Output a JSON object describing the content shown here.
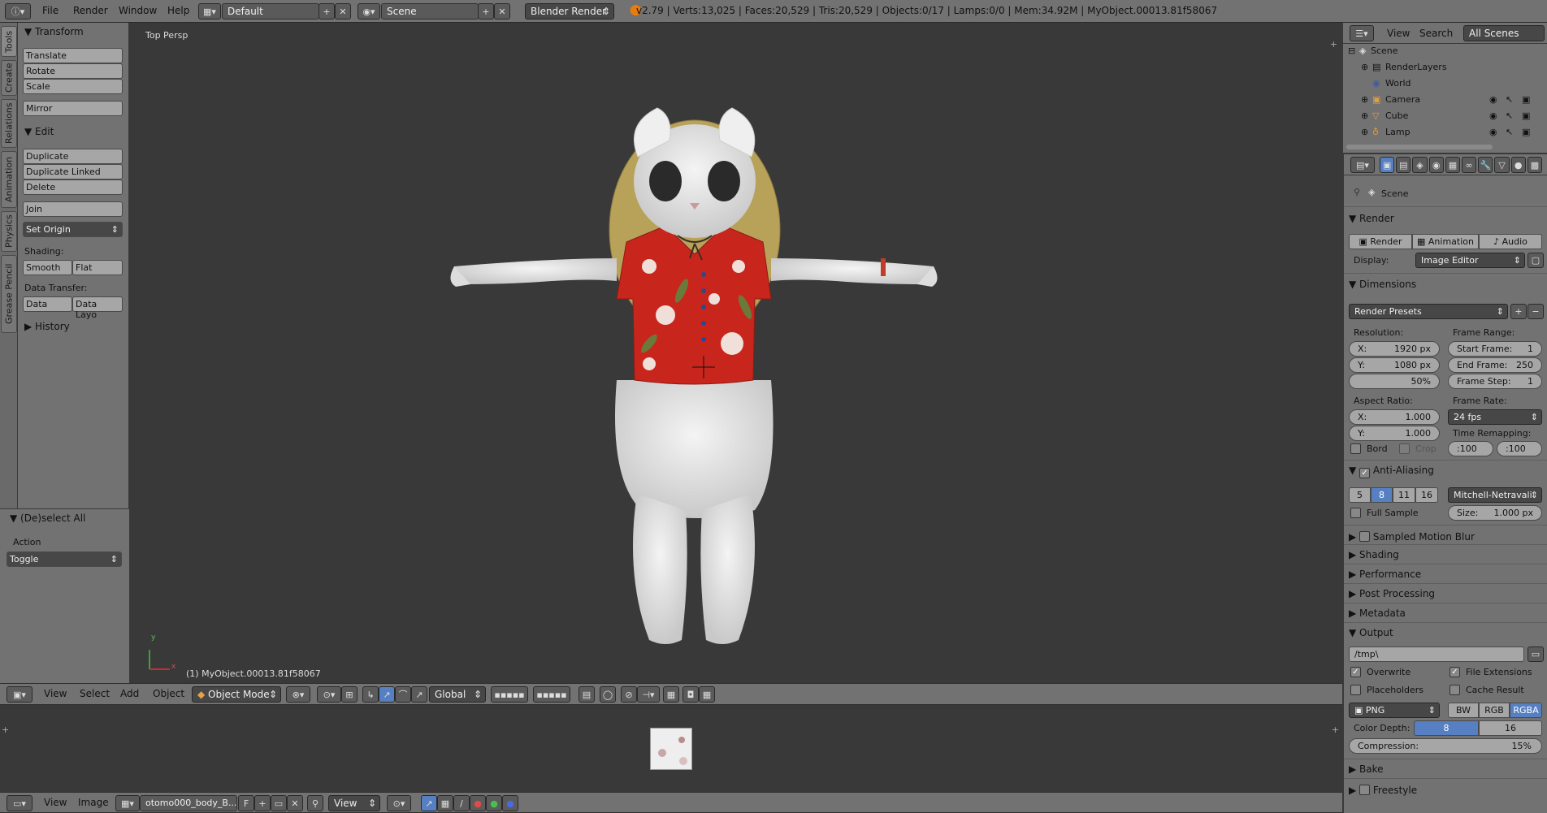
{
  "topbar": {
    "menus": [
      "File",
      "Render",
      "Window",
      "Help"
    ],
    "layout": "Default",
    "scene": "Scene",
    "engine": "Blender Render",
    "stats": "v2.79 | Verts:13,025 | Faces:20,529 | Tris:20,529 | Objects:0/17 | Lamps:0/0 | Mem:34.92M | MyObject.00013.81f58067"
  },
  "tabs": [
    "Tools",
    "Create",
    "Relations",
    "Animation",
    "Physics",
    "Grease Pencil"
  ],
  "toolshelf": {
    "transform_title": "Transform",
    "translate": "Translate",
    "rotate": "Rotate",
    "scale": "Scale",
    "mirror": "Mirror",
    "edit_title": "Edit",
    "duplicate": "Duplicate",
    "duplicate_linked": "Duplicate Linked",
    "delete": "Delete",
    "join": "Join",
    "set_origin": "Set Origin",
    "shading_label": "Shading:",
    "smooth": "Smooth",
    "flat": "Flat",
    "data_transfer_label": "Data Transfer:",
    "data": "Data",
    "data_layout": "Data Layo",
    "history_title": "History"
  },
  "operator": {
    "title": "(De)select All",
    "action_label": "Action",
    "action_value": "Toggle"
  },
  "viewport": {
    "view_name": "Top Persp",
    "object_label": "(1) MyObject.00013.81f58067",
    "axis_x": "x",
    "axis_y": "y"
  },
  "view3d_header": {
    "view": "View",
    "select": "Select",
    "add": "Add",
    "object": "Object",
    "mode": "Object Mode",
    "orientation": "Global"
  },
  "image_header": {
    "view": "View",
    "image": "Image",
    "image_name": "otomo000_body_B...",
    "fake_user": "F",
    "view_menu": "View"
  },
  "outliner": {
    "view": "View",
    "search": "Search",
    "filter": "All Scenes",
    "items": [
      "Scene",
      "RenderLayers",
      "World",
      "Camera",
      "Cube",
      "Lamp"
    ]
  },
  "properties": {
    "context": "Scene",
    "render_title": "Render",
    "render_btn": "Render",
    "animation_btn": "Animation",
    "audio_btn": "Audio",
    "display_label": "Display:",
    "display_value": "Image Editor",
    "dimensions_title": "Dimensions",
    "render_presets": "Render Presets",
    "resolution_label": "Resolution:",
    "res_x": "X:",
    "res_x_val": "1920 px",
    "res_y": "Y:",
    "res_y_val": "1080 px",
    "res_pct": "50%",
    "frame_range_label": "Frame Range:",
    "start_frame": "Start Frame:",
    "start_frame_val": "1",
    "end_frame": "End Frame:",
    "end_frame_val": "250",
    "frame_step": "Frame Step:",
    "frame_step_val": "1",
    "aspect_label": "Aspect Ratio:",
    "asp_x": "X:",
    "asp_x_val": "1.000",
    "asp_y": "Y:",
    "asp_y_val": "1.000",
    "frame_rate_label": "Frame Rate:",
    "frame_rate_val": "24 fps",
    "time_remap_label": "Time Remapping:",
    "remap_old": ":100",
    "remap_new": ":100",
    "bord": "Bord",
    "crop": "Crop",
    "aa_title": "Anti-Aliasing",
    "aa_5": "5",
    "aa_8": "8",
    "aa_11": "11",
    "aa_16": "16",
    "aa_filter": "Mitchell-Netravali",
    "full_sample": "Full Sample",
    "size_label": "Size:",
    "size_val": "1.000 px",
    "motion_blur": "Sampled Motion Blur",
    "shading": "Shading",
    "performance": "Performance",
    "post_processing": "Post Processing",
    "metadata": "Metadata",
    "output_title": "Output",
    "output_path": "/tmp\\",
    "overwrite": "Overwrite",
    "file_extensions": "File Extensions",
    "placeholders": "Placeholders",
    "cache_result": "Cache Result",
    "format": "PNG",
    "bw": "BW",
    "rgb": "RGB",
    "rgba": "RGBA",
    "color_depth_label": "Color Depth:",
    "depth_8": "8",
    "depth_16": "16",
    "compression_label": "Compression:",
    "compression_val": "15%",
    "bake": "Bake",
    "freestyle": "Freestyle"
  },
  "colors": {
    "accent": "#5680c2",
    "shirt": "#c8261d",
    "fur": "#e8e8e8"
  }
}
